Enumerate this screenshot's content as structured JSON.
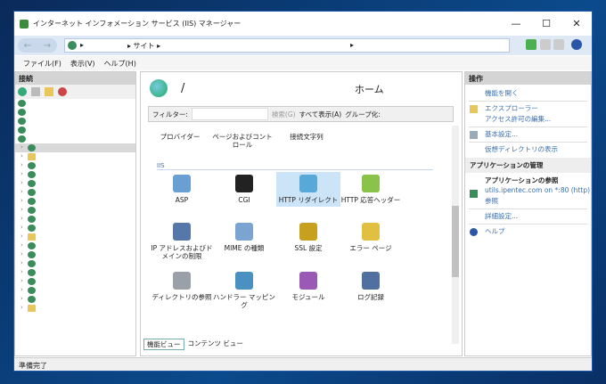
{
  "window": {
    "title": "インターネット インフォメーション サービス (IIS) マネージャー",
    "controls": [
      "—",
      "☐",
      "✕"
    ]
  },
  "address": {
    "segments": [
      "▸",
      "▸ サイト ▸",
      "▸"
    ]
  },
  "menu": [
    "ファイル(F)",
    "表示(V)",
    "ヘルプ(H)"
  ],
  "connections": {
    "title": "接続",
    "tree": [
      "globe",
      "globe",
      "globe",
      "globe",
      "globe",
      "globe",
      "folder",
      "globe",
      "globe",
      "globe",
      "globe",
      "globe",
      "globe",
      "globe",
      "globe",
      "folder",
      "globe",
      "globe",
      "globe",
      "globe",
      "globe",
      "globe",
      "globe",
      "folder"
    ]
  },
  "center": {
    "path": "/",
    "home_label": "ホーム",
    "filter": {
      "label": "フィルター:",
      "search": "検索(G)",
      "show_all": "すべて表示(A)",
      "group": "グループ化:"
    },
    "top_features": [
      "プロバイダー",
      "ページおよびコントロール",
      "接続文字列"
    ],
    "group": "IIS",
    "features": [
      {
        "label": "ASP",
        "color": "#6a9fd4"
      },
      {
        "label": "CGI",
        "color": "#222222"
      },
      {
        "label": "HTTP リダイレクト",
        "color": "#58a8d8",
        "selected": true
      },
      {
        "label": "HTTP 応答ヘッダー",
        "color": "#8bc34a"
      },
      {
        "label": "IP アドレスおよびドメインの制限",
        "color": "#5577aa"
      },
      {
        "label": "MIME の種類",
        "color": "#7aa5d0"
      },
      {
        "label": "SSL 設定",
        "color": "#c8a020"
      },
      {
        "label": "エラー ページ",
        "color": "#e0c040"
      },
      {
        "label": "ディレクトリの参照",
        "color": "#9aa0a8"
      },
      {
        "label": "ハンドラー マッピング",
        "color": "#4a90c0"
      },
      {
        "label": "モジュール",
        "color": "#9b59b6"
      },
      {
        "label": "ログ記録",
        "color": "#5070a0"
      }
    ],
    "view_tabs": [
      "機能ビュー",
      "コンテンツ ビュー"
    ]
  },
  "actions": {
    "title": "操作",
    "items": [
      "機能を開く",
      "エクスプローラー",
      "アクセス許可の編集...",
      "基本設定...",
      "仮想ディレクトリの表示"
    ],
    "app_section": "アプリケーションの管理",
    "browse_title": "アプリケーションの参照",
    "browse_link": "utils.ipentec.com on *:80 (http)",
    "browse_link2": "参照",
    "advanced": "詳細設定...",
    "help": "ヘルプ"
  },
  "status": "準備完了"
}
